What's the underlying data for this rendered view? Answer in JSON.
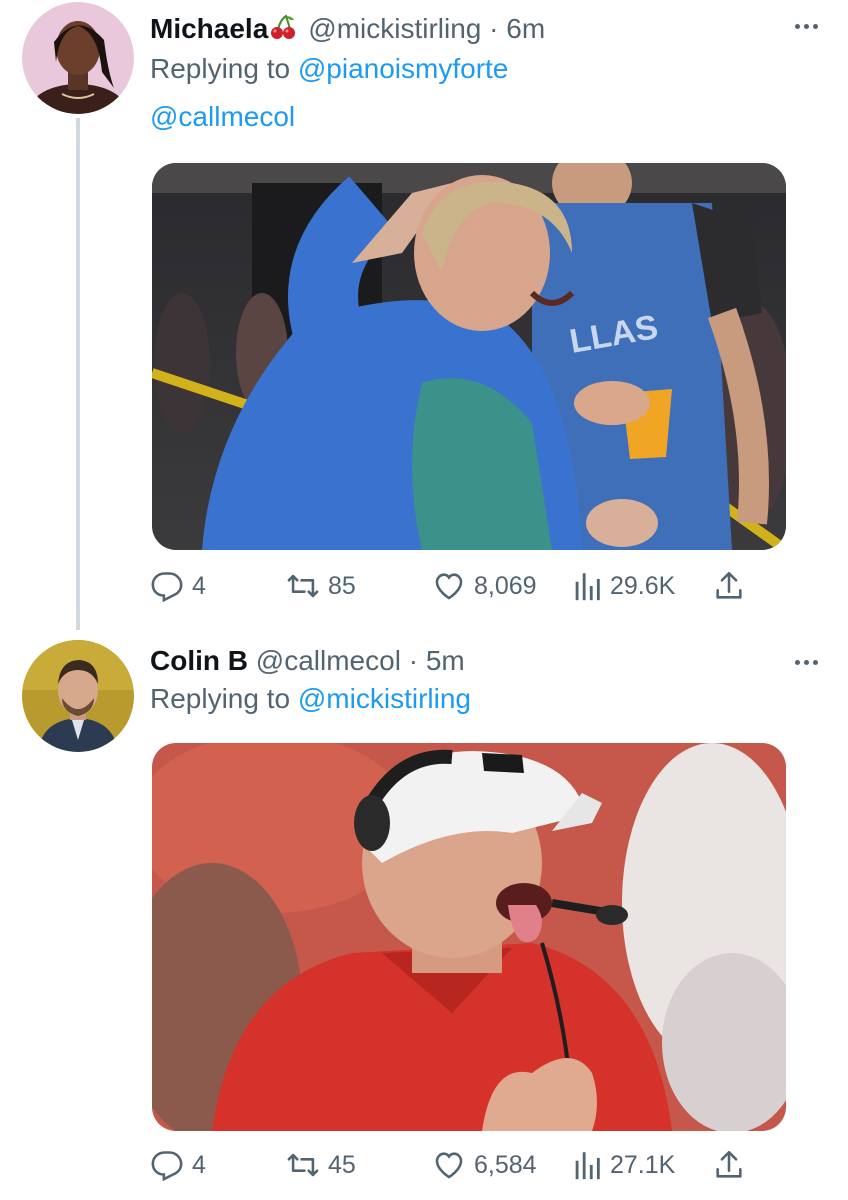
{
  "tweets": [
    {
      "display_name": "Michaela",
      "name_emoji": "cherries",
      "handle": "@mickistirling",
      "separator": "·",
      "time": "6m",
      "replying_prefix": "Replying to",
      "replying_to": "@pianoismyforte",
      "mention": "@callmecol",
      "media_description": "woman in blue sweatshirt waving at a basketball game",
      "stats": {
        "replies": "4",
        "retweets": "85",
        "likes": "8,069",
        "views": "29.6K"
      }
    },
    {
      "display_name": "Colin B",
      "handle": "@callmecol",
      "separator": "·",
      "time": "5m",
      "replying_prefix": "Replying to",
      "replying_to": "@mickistirling",
      "media_description": "man in white cap and red shirt with headset sticking out tongue",
      "stats": {
        "replies": "4",
        "retweets": "45",
        "likes": "6,584",
        "views": "27.1K"
      }
    }
  ],
  "icons": {
    "more": "more-horizontal-icon",
    "reply": "reply-icon",
    "retweet": "retweet-icon",
    "like": "heart-icon",
    "views": "views-icon",
    "share": "share-icon"
  },
  "colors": {
    "text_primary": "#0f1419",
    "text_secondary": "#536471",
    "link": "#1d9bf0",
    "thread_line": "#cfd9de"
  }
}
